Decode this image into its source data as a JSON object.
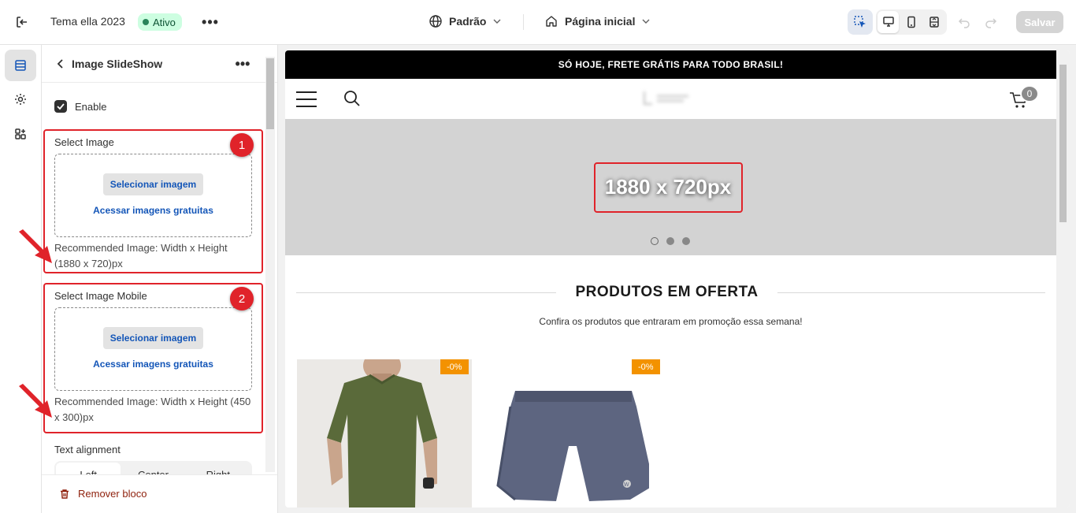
{
  "topbar": {
    "theme_name": "Tema ella 2023",
    "status_badge": "Ativo",
    "language_select": "Padrão",
    "page_select": "Página inicial",
    "save_label": "Salvar"
  },
  "panel": {
    "title": "Image SlideShow",
    "enable_label": "Enable",
    "enable_checked": true,
    "fields": [
      {
        "label": "Select Image",
        "select_button": "Selecionar imagem",
        "free_images_link": "Acessar imagens gratuitas",
        "help": "Recommended Image: Width x Height (1880 x 720)px",
        "annotation_number": "1"
      },
      {
        "label": "Select Image Mobile",
        "select_button": "Selecionar imagem",
        "free_images_link": "Acessar imagens gratuitas",
        "help": "Recommended Image: Width x Height (450 x 300)px",
        "annotation_number": "2"
      }
    ],
    "text_alignment_label": "Text alignment",
    "alignment_options": [
      "Left",
      "Center",
      "Right"
    ],
    "alignment_selected": "Left",
    "remove_block_label": "Remover bloco"
  },
  "preview": {
    "announcement": "SÓ HOJE, FRETE GRÁTIS PARA TODO BRASIL!",
    "cart_count": "0",
    "banner_text": "1880 x 720px",
    "slide_count": 3,
    "active_slide": 1,
    "section_title": "PRODUTOS EM OFERTA",
    "section_subtitle": "Confira os produtos que entraram em promoção essa semana!",
    "products": [
      {
        "discount": "-0%",
        "image": "green-tshirt"
      },
      {
        "discount": "-0%",
        "image": "gray-shorts"
      }
    ]
  },
  "colors": {
    "annotation_red": "#e0232a",
    "link_blue": "#1456b8",
    "badge_green": "#cdfee1",
    "discount_orange": "#f39200",
    "remove_red": "#8e1f0b"
  }
}
